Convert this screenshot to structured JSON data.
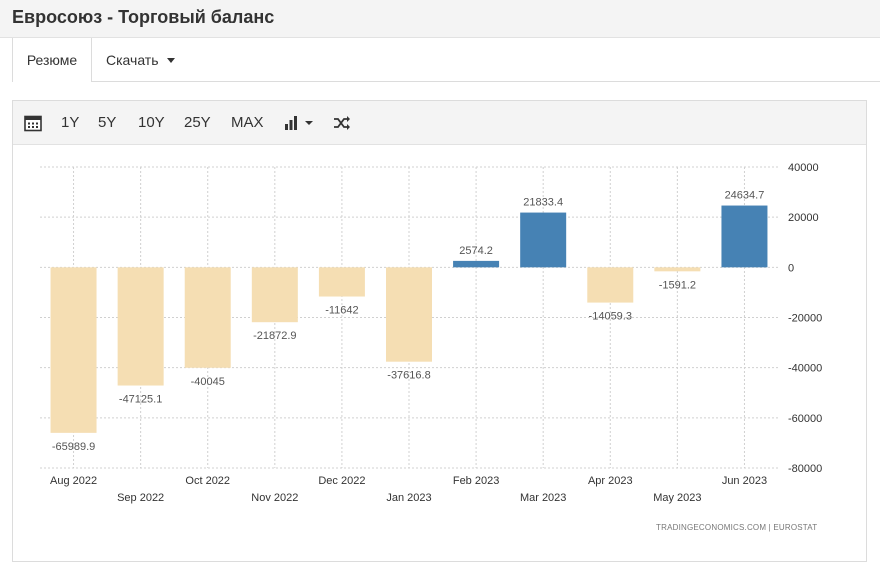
{
  "header": {
    "title": "Евросоюз - Торговый баланс"
  },
  "tabs": {
    "summary": "Резюме",
    "download": "Скачать"
  },
  "toolbar": {
    "r1y": "1Y",
    "r5y": "5Y",
    "r10y": "10Y",
    "r25y": "25Y",
    "rmax": "MAX"
  },
  "icons": {
    "calendar": "calendar-icon",
    "chart_type": "bar-chart-icon",
    "shuffle": "shuffle-icon"
  },
  "source": "TRADINGECONOMICS.COM | EUROSTAT",
  "colors": {
    "negative": "#f5deb3",
    "positive": "#4682b4"
  },
  "chart_data": {
    "type": "bar",
    "categories": [
      "Aug 2022",
      "Sep 2022",
      "Oct 2022",
      "Nov 2022",
      "Dec 2022",
      "Jan 2023",
      "Feb 2023",
      "Mar 2023",
      "Apr 2023",
      "May 2023",
      "Jun 2023"
    ],
    "values": [
      -65989.9,
      -47125.1,
      -40045,
      -21872.9,
      -11642,
      -37616.8,
      2574.2,
      21833.4,
      -14059.3,
      -1591.2,
      24634.7
    ],
    "value_labels": [
      "-65989.9",
      "-47125.1",
      "-40045",
      "-21872.9",
      "-11642",
      "-37616.8",
      "2574.2",
      "21833.4",
      "-14059.3",
      "-1591.2",
      "24634.7"
    ],
    "yticks": [
      "40000",
      "20000",
      "0",
      "-20000",
      "-40000",
      "-60000",
      "-80000"
    ],
    "ylim": [
      -80000,
      40000
    ],
    "grid": true,
    "title": "",
    "xlabel": "",
    "ylabel": ""
  }
}
